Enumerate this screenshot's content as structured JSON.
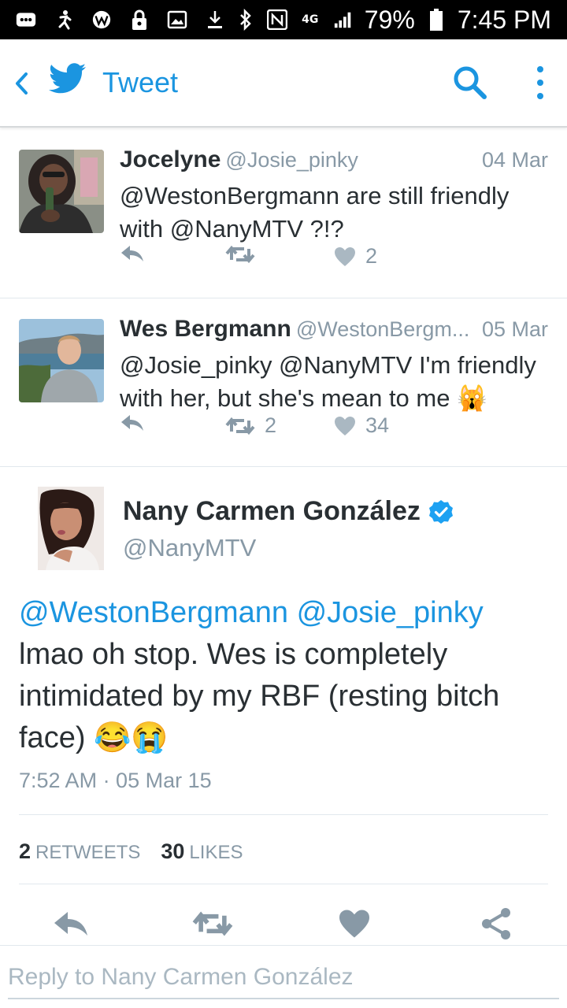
{
  "status_bar": {
    "battery": "79%",
    "time": "7:45 PM",
    "network": "4G"
  },
  "header": {
    "title": "Tweet"
  },
  "replies": [
    {
      "name": "Jocelyne",
      "handle": "@Josie_pinky",
      "date": "04 Mar",
      "text": "@WestonBergmann are still friendly with @NanyMTV ?!?",
      "retweets": "",
      "likes": "2"
    },
    {
      "name": "Wes Bergmann",
      "handle": "@WestonBergm...",
      "date": "05 Mar",
      "text": "@Josie_pinky @NanyMTV I'm friendly with her, but she's mean to me 🙀",
      "retweets": "2",
      "likes": "34"
    }
  ],
  "focused_tweet": {
    "name": "Nany Carmen González",
    "handle": "@NanyMTV",
    "mention_1": "@WestonBergmann",
    "mention_2": "@Josie_pinky",
    "text": "lmao oh stop. Wes is completely intimidated by my RBF (resting bitch face) 😂😭",
    "timestamp": "7:52 AM · 05 Mar 15",
    "retweet_count": "2",
    "retweet_label": "RETWEETS",
    "like_count": "30",
    "like_label": "LIKES"
  },
  "reply_bar": {
    "placeholder": "Reply to Nany Carmen González"
  },
  "colors": {
    "accent": "#1b95e0",
    "muted": "#8899a6",
    "text": "#292f33"
  }
}
